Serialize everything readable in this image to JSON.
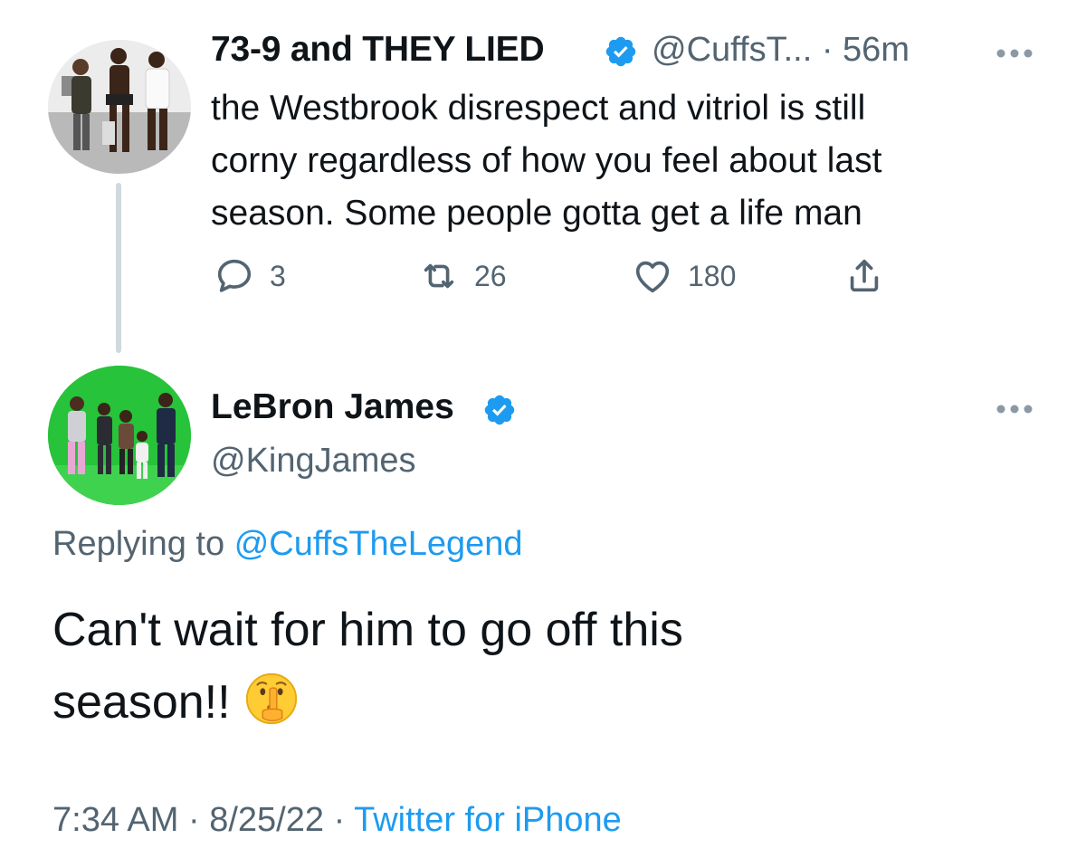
{
  "tweet1": {
    "display_name": "73-9 and THEY LIED",
    "handle": "@CuffsT...",
    "separator": "·",
    "time_ago": "56m",
    "text": "the Westbrook disrespect and vitriol is still\ncorny regardless of how you feel about last\nseason. Some people gotta get a life man",
    "reply_count": "3",
    "retweet_count": "26",
    "like_count": "180",
    "avatar_icon": "profile-photo-group-of-people",
    "verified_icon": "verified-badge-icon"
  },
  "tweet2": {
    "display_name": "LeBron James",
    "handle": "@KingJames",
    "replying_label": "Replying to",
    "replying_mention": "@CuffsTheLegend",
    "text": "Can't wait for him to go off this\nseason!!",
    "emoji": "shushing-face-emoji",
    "time": "7:34 AM",
    "separator": "·",
    "date": "8/25/22",
    "source": "Twitter for iPhone",
    "avatar_icon": "profile-photo-green-screen-family",
    "verified_icon": "verified-badge-icon"
  },
  "colors": {
    "verified_blue": "#1d9bf0",
    "secondary_text": "#536471",
    "primary_text": "#0f1419",
    "thread_line": "#cfd9de",
    "avatar2_bg": "#27c33a"
  }
}
